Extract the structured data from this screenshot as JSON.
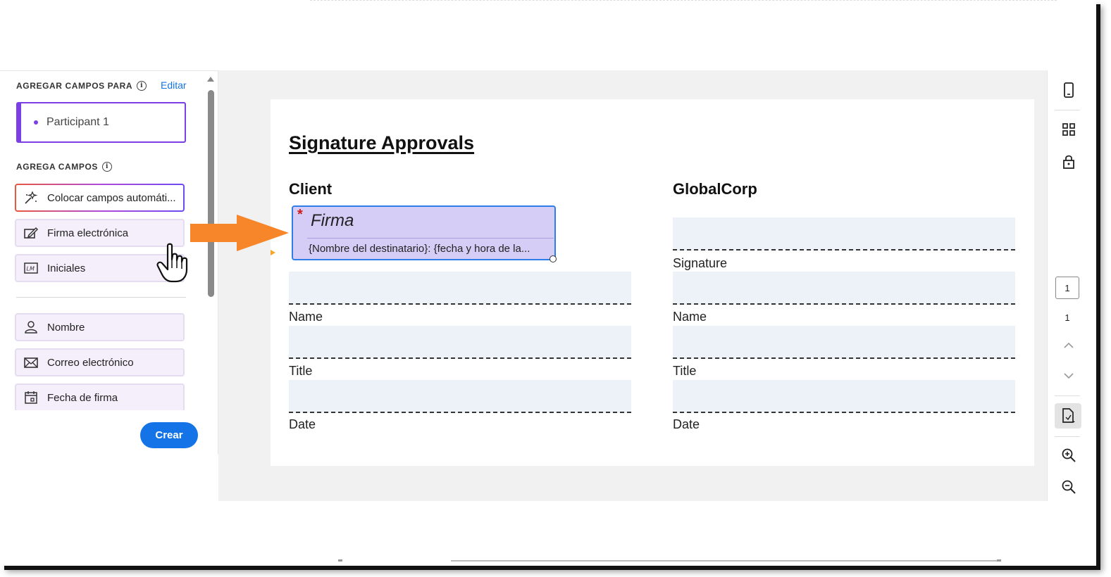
{
  "left_panel": {
    "add_fields_for_label": "AGREGAR CAMPOS PARA",
    "edit_link": "Editar",
    "participant": "Participant 1",
    "add_fields_label": "AGREGA CAMPOS",
    "fields": [
      {
        "label": "Colocar campos automáti...",
        "icon": "auto-place-icon"
      },
      {
        "label": "Firma electrónica",
        "icon": "signature-icon"
      },
      {
        "label": "Iniciales",
        "icon": "initials-icon"
      }
    ],
    "info_fields": [
      {
        "label": "Nombre",
        "icon": "person-icon"
      },
      {
        "label": "Correo electrónico",
        "icon": "mail-icon"
      },
      {
        "label": "Fecha de firma",
        "icon": "calendar-icon"
      }
    ],
    "create_button": "Crear"
  },
  "document": {
    "title": "Signature Approvals",
    "client_heading": "Client",
    "globalcorp_heading": "GlobalCorp",
    "firma_field": {
      "required_mark": "*",
      "label": "Firma",
      "sublabel": "{Nombre del destinatario}: {fecha y hora de la..."
    },
    "client_labels": [
      "Name",
      "Title",
      "Date"
    ],
    "globalcorp_labels": [
      "Signature",
      "Name",
      "Title",
      "Date"
    ]
  },
  "right_rail": {
    "current_page": "1",
    "total_pages": "1",
    "icons": [
      "mobile-icon",
      "grid-icon",
      "lock-icon",
      "chevron-up-icon",
      "chevron-down-icon",
      "document-edit-icon",
      "zoom-in-icon",
      "zoom-out-icon"
    ]
  },
  "colors": {
    "accent": "#1473e6",
    "participant": "#7b3fe4",
    "field_fill": "#d6cdf6",
    "arrow": "#f7862a"
  }
}
